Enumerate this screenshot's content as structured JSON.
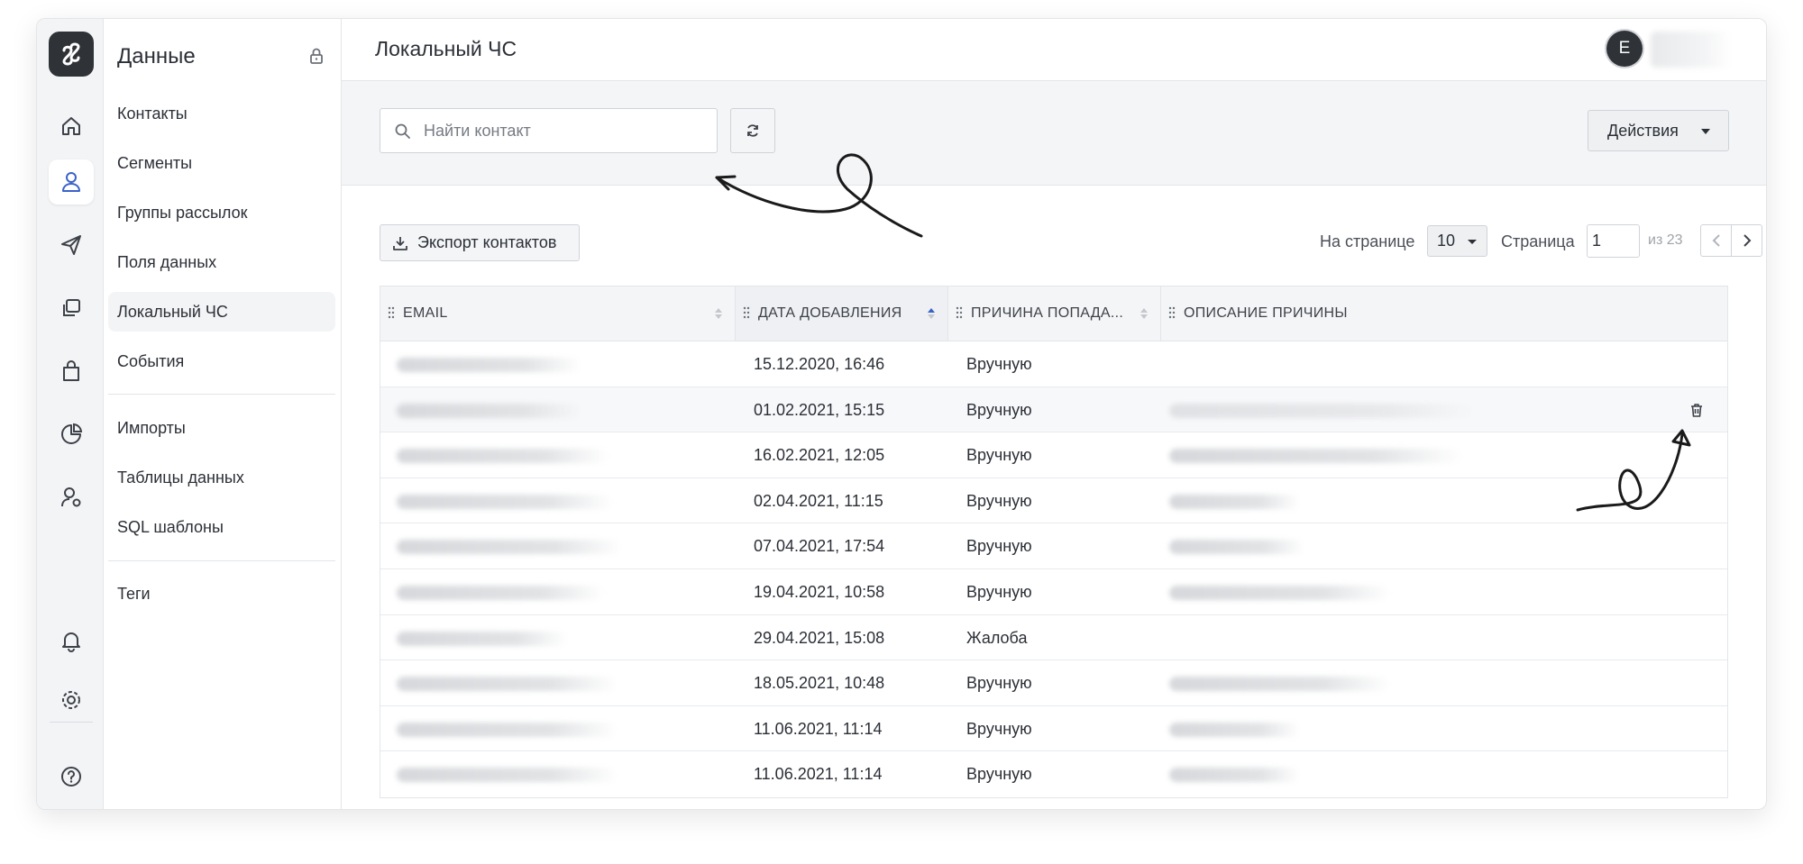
{
  "sidebar": {
    "title": "Данные",
    "items": [
      {
        "label": "Контакты"
      },
      {
        "label": "Сегменты"
      },
      {
        "label": "Группы рассылок"
      },
      {
        "label": "Поля данных"
      },
      {
        "label": "Локальный ЧС"
      },
      {
        "label": "События"
      },
      {
        "label": "Импорты"
      },
      {
        "label": "Таблицы данных"
      },
      {
        "label": "SQL шаблоны"
      },
      {
        "label": "Теги"
      }
    ]
  },
  "header": {
    "title": "Локальный ЧС",
    "avatar_letter": "E"
  },
  "toolbar": {
    "search_placeholder": "Найти контакт",
    "actions_label": "Действия"
  },
  "list_controls": {
    "export_label": "Экспорт контактов",
    "per_page_label": "На странице",
    "per_page_value": "10",
    "page_label": "Страница",
    "page_value": "1",
    "page_of": "из 23"
  },
  "table": {
    "columns": [
      "EMAIL",
      "ДАТА ДОБАВЛЕНИЯ",
      "ПРИЧИНА ПОПАДА...",
      "ОПИСАНИЕ ПРИЧИНЫ"
    ],
    "rows": [
      {
        "date": "15.12.2020, 16:46",
        "reason": "Вручную"
      },
      {
        "date": "01.02.2021, 15:15",
        "reason": "Вручную"
      },
      {
        "date": "16.02.2021, 12:05",
        "reason": "Вручную"
      },
      {
        "date": "02.04.2021, 11:15",
        "reason": "Вручную"
      },
      {
        "date": "07.04.2021, 17:54",
        "reason": "Вручную"
      },
      {
        "date": "19.04.2021, 10:58",
        "reason": "Вручную"
      },
      {
        "date": "29.04.2021, 15:08",
        "reason": "Жалоба"
      },
      {
        "date": "18.05.2021, 10:48",
        "reason": "Вручную"
      },
      {
        "date": "11.06.2021, 11:14",
        "reason": "Вручную"
      },
      {
        "date": "11.06.2021, 11:14",
        "reason": "Вручную"
      }
    ]
  },
  "colors": {
    "accent": "#3a63c8",
    "dark": "#2f3338",
    "muted_bg": "#f4f5f7"
  }
}
